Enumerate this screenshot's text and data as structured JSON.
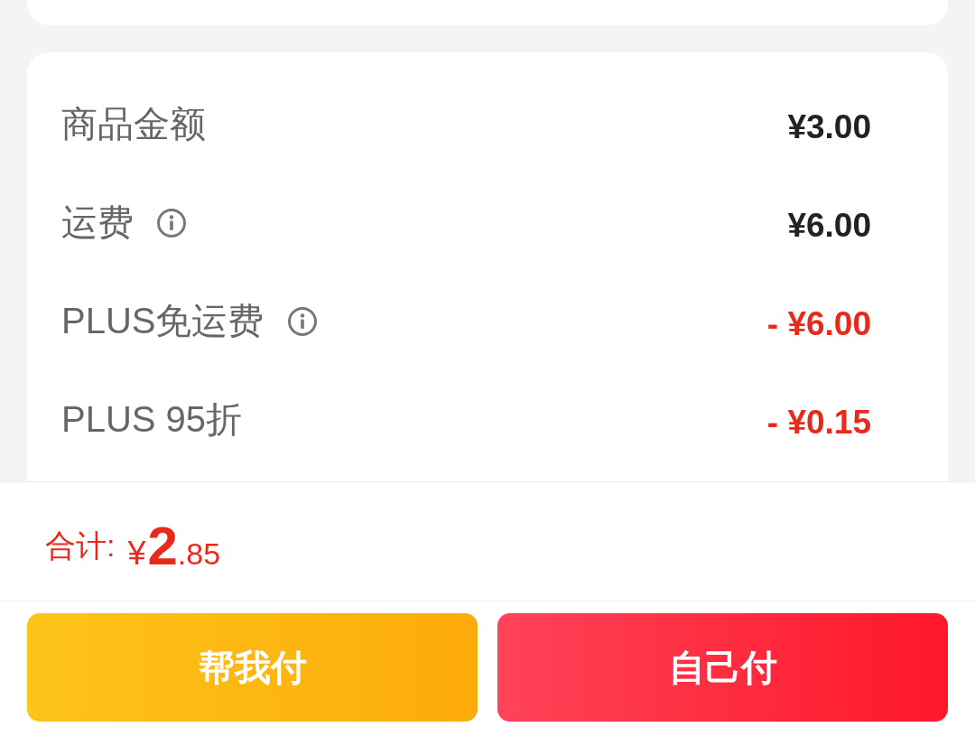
{
  "summary": {
    "rows": [
      {
        "label": "商品金额",
        "info": false,
        "kind": "charge",
        "value": "¥3.00"
      },
      {
        "label": "运费",
        "info": true,
        "kind": "charge",
        "value": "¥6.00"
      },
      {
        "label": "PLUS免运费",
        "info": true,
        "kind": "discount",
        "value": "- ¥6.00"
      },
      {
        "label": "PLUS 95折",
        "info": false,
        "kind": "discount",
        "value": "- ¥0.15"
      }
    ]
  },
  "total": {
    "label": "合计:",
    "currency": "¥",
    "integer": "2",
    "decimal": ".85"
  },
  "buttons": [
    {
      "label": "帮我付",
      "kind": "secondary"
    },
    {
      "label": "自己付",
      "kind": "primary"
    }
  ]
}
